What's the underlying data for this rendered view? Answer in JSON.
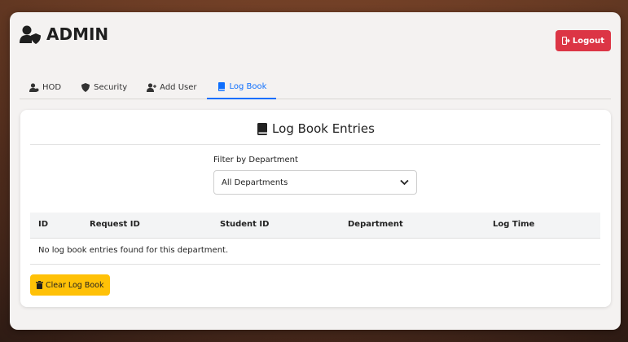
{
  "header": {
    "title": "ADMIN",
    "logout_label": "Logout"
  },
  "tabs": [
    {
      "label": "HOD",
      "icon": "user-tie-icon",
      "active": false
    },
    {
      "label": "Security",
      "icon": "shield-icon",
      "active": false
    },
    {
      "label": "Add User",
      "icon": "user-plus-icon",
      "active": false
    },
    {
      "label": "Log Book",
      "icon": "book-icon",
      "active": true
    }
  ],
  "logbook": {
    "title": "Log Book Entries",
    "filter_label": "Filter by Department",
    "filter_selected": "All Departments",
    "columns": [
      "ID",
      "Request ID",
      "Student ID",
      "Department",
      "Log Time"
    ],
    "empty_message": "No log book entries found for this department.",
    "clear_label": "Clear Log Book"
  },
  "colors": {
    "danger": "#dc3545",
    "warning": "#ffc107",
    "primary": "#0d6efd"
  }
}
